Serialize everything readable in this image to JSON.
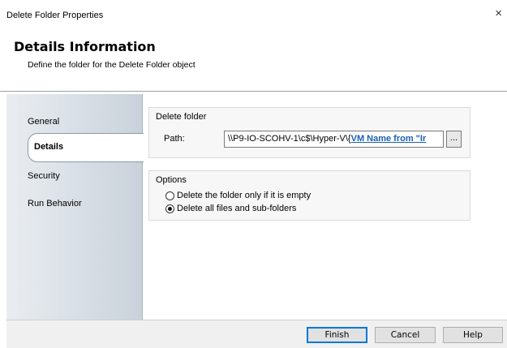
{
  "window": {
    "title": "Delete Folder Properties",
    "close_glyph": "×"
  },
  "header": {
    "title": "Details Information",
    "subtitle": "Define the folder for the Delete Folder object"
  },
  "sidebar": {
    "tabs": [
      {
        "label": "General",
        "active": false
      },
      {
        "label": "Details",
        "active": true
      },
      {
        "label": "Security",
        "active": false
      },
      {
        "label": "Run Behavior",
        "active": false
      }
    ]
  },
  "delete_folder": {
    "legend": "Delete folder",
    "path_label": "Path:",
    "path_prefix": "\\\\P9-IO-SCOHV-1\\c$\\Hyper-V\\{",
    "path_token": "VM Name from \"Ir",
    "browse_label": "..."
  },
  "options": {
    "legend": "Options",
    "items": [
      {
        "label": "Delete the folder only if it is empty",
        "checked": false
      },
      {
        "label": "Delete all files and sub-folders",
        "checked": true
      }
    ]
  },
  "footer": {
    "finish_label": "Finish",
    "cancel_label": "Cancel",
    "help_label": "Help"
  },
  "colors": {
    "sidebar_gradient_start": "#e9edf1",
    "sidebar_gradient_end": "#c9d2db",
    "link_token": "#1a5fb4",
    "primary_button_border": "#0078d7"
  }
}
